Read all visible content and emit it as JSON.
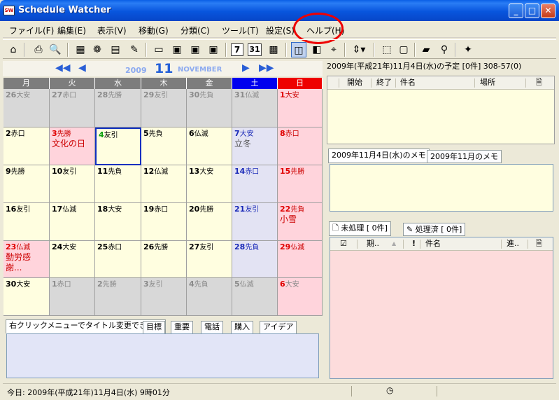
{
  "window": {
    "title": "Schedule Watcher",
    "icon_text": "SW",
    "minimize_icon": "minimize-icon",
    "maximize_icon": "maximize-icon",
    "close_icon": "close-icon"
  },
  "menu": [
    "ファイル(F)",
    "編集(E)",
    "表示(V)",
    "移動(G)",
    "分類(C)",
    "ツール(T)",
    "設定(S)",
    "ヘルプ(H)"
  ],
  "calendar": {
    "year": "2009",
    "month": "11",
    "month_name": "NOVEMBER",
    "weekdays": [
      "月",
      "火",
      "水",
      "木",
      "金",
      "土",
      "日"
    ],
    "weekday_colors": [
      "#7d7d7d",
      "#7d7d7d",
      "#7d7d7d",
      "#7d7d7d",
      "#7d7d7d",
      "#0000ee",
      "#ee0000"
    ],
    "weeks": [
      [
        {
          "d": "26",
          "r": "大安",
          "o": true
        },
        {
          "d": "27",
          "r": "赤口",
          "o": true
        },
        {
          "d": "28",
          "r": "先勝",
          "o": true
        },
        {
          "d": "29",
          "r": "友引",
          "o": true
        },
        {
          "d": "30",
          "r": "先負",
          "o": true
        },
        {
          "d": "31",
          "r": "仏滅",
          "o": true
        },
        {
          "d": "1",
          "r": "大安"
        }
      ],
      [
        {
          "d": "2",
          "r": "赤口"
        },
        {
          "d": "3",
          "r": "先勝",
          "h": "文化の日"
        },
        {
          "d": "4",
          "r": "友引",
          "today": true
        },
        {
          "d": "5",
          "r": "先負"
        },
        {
          "d": "6",
          "r": "仏滅"
        },
        {
          "d": "7",
          "r": "大安",
          "h": "立冬"
        },
        {
          "d": "8",
          "r": "赤口"
        }
      ],
      [
        {
          "d": "9",
          "r": "先勝"
        },
        {
          "d": "10",
          "r": "友引"
        },
        {
          "d": "11",
          "r": "先負"
        },
        {
          "d": "12",
          "r": "仏滅"
        },
        {
          "d": "13",
          "r": "大安"
        },
        {
          "d": "14",
          "r": "赤口"
        },
        {
          "d": "15",
          "r": "先勝"
        }
      ],
      [
        {
          "d": "16",
          "r": "友引"
        },
        {
          "d": "17",
          "r": "仏滅"
        },
        {
          "d": "18",
          "r": "大安"
        },
        {
          "d": "19",
          "r": "赤口"
        },
        {
          "d": "20",
          "r": "先勝"
        },
        {
          "d": "21",
          "r": "友引"
        },
        {
          "d": "22",
          "r": "先負",
          "h": "小雪"
        }
      ],
      [
        {
          "d": "23",
          "r": "仏滅",
          "h": "勤労感謝..."
        },
        {
          "d": "24",
          "r": "大安"
        },
        {
          "d": "25",
          "r": "赤口"
        },
        {
          "d": "26",
          "r": "先勝"
        },
        {
          "d": "27",
          "r": "友引"
        },
        {
          "d": "28",
          "r": "先負"
        },
        {
          "d": "29",
          "r": "仏滅"
        }
      ],
      [
        {
          "d": "30",
          "r": "大安"
        },
        {
          "d": "1",
          "r": "赤口",
          "o": true
        },
        {
          "d": "2",
          "r": "先勝",
          "o": true
        },
        {
          "d": "3",
          "r": "友引",
          "o": true
        },
        {
          "d": "4",
          "r": "先負",
          "o": true
        },
        {
          "d": "5",
          "r": "仏滅",
          "o": true
        },
        {
          "d": "6",
          "r": "大安",
          "o": true
        }
      ]
    ]
  },
  "bottom_tabs": [
    "右クリックメニューでタイトル変更できます",
    "目標",
    "重要",
    "電話",
    "購入",
    "アイデア"
  ],
  "schedule": {
    "header": "2009年(平成21年)11月4日(水)の予定 [0件] 308-57(0)",
    "columns": [
      "開始",
      "終了",
      "件名",
      "場所"
    ]
  },
  "memo_tabs": [
    "2009年11月4日(水)のメモ",
    "2009年11月のメモ"
  ],
  "todo": {
    "tabs": [
      "未処理 [ 0件]",
      "処理済 [ 0件]"
    ],
    "columns": [
      "期..",
      "件名",
      "進.."
    ]
  },
  "status": {
    "text": "今日: 2009年(平成21年)11月4日(水) 9時01分"
  },
  "colors": {
    "title_bar": "#0855dd",
    "saturday_bg": "#e3e3f3",
    "sunday_bg": "#ffd4dc",
    "weekday_bg": "#fffee0",
    "other_month_bg": "#d8d8d8",
    "today_border": "#1030c0",
    "highlight": "#e00000"
  }
}
